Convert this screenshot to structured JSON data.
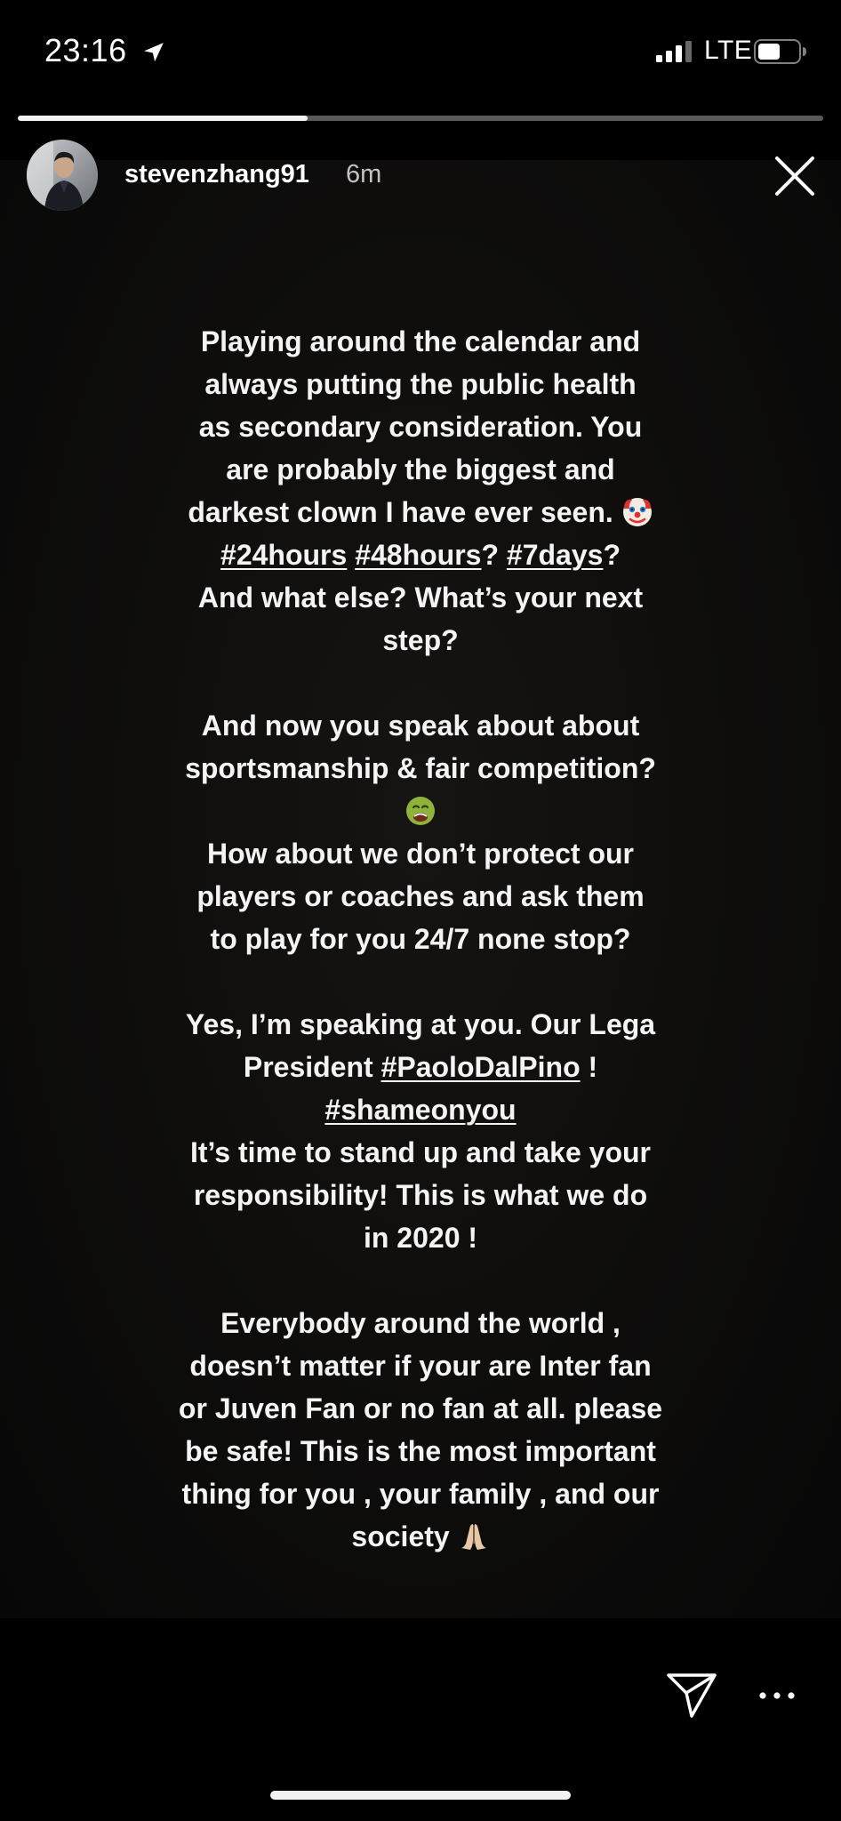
{
  "status_bar": {
    "time": "23:16",
    "network": "LTE",
    "icons": [
      "location-arrow-icon",
      "signal-icon",
      "battery-icon"
    ]
  },
  "story": {
    "progress": 0.36,
    "username": "stevenzhang91",
    "posted": "6m",
    "paragraphs": {
      "p1": {
        "line1": "Playing around the calendar and",
        "line2": "always putting the public health",
        "line3": "as secondary consideration. You",
        "line4": "are probably the biggest and",
        "line5": "darkest clown I have ever seen.",
        "tag1": "#24hours",
        "tag2": "#48hours",
        "sep1": "?",
        "tag3": "#7days",
        "sep2": "?",
        "line7": "And what else?  What’s your next",
        "line8": "step?"
      },
      "p2": {
        "line1": "And now you speak about about",
        "line2": "sportsmanship & fair competition?",
        "line4": "How about we don’t protect our",
        "line5": "players or coaches and ask them",
        "line6": "to play for you 24/7 none stop?"
      },
      "p3": {
        "line1": "Yes, I’m speaking at you. Our Lega",
        "line2_prefix": "President",
        "tag_person": "#PaoloDalPino",
        "line2_suffix": "!",
        "tag_shame": "#shameonyou",
        "line4": "It’s time to stand up and take your",
        "line5": "responsibility!  This is what we do",
        "line6": "in 2020 !"
      },
      "p4": {
        "line1": "Everybody around the world ,",
        "line2": "doesn’t matter if your are Inter fan",
        "line3": "or Juven Fan or no fan at all. please",
        "line4": "be safe! This is the most important",
        "line5": "thing for you , your family , and our",
        "line6": "society"
      }
    },
    "emojis": [
      "clown-face-emoji",
      "nauseated-face-emoji",
      "praying-hands-emoji"
    ]
  },
  "footer": {
    "icons": [
      "send-icon",
      "more-icon"
    ]
  },
  "colors": {
    "background": "#000000",
    "text": "#f4f4f4",
    "progress_fill": "#f2f2f2"
  }
}
